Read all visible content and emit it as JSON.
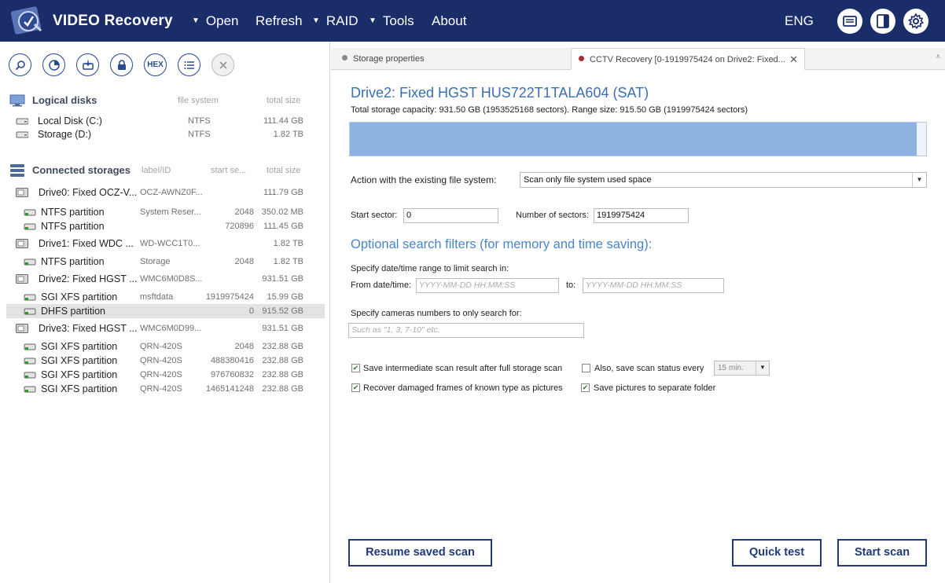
{
  "app": {
    "title": "VIDEO Recovery",
    "menu": [
      {
        "label": "Open",
        "has_arrow": true
      },
      {
        "label": "Refresh",
        "has_arrow": false
      },
      {
        "label": "RAID",
        "has_arrow": true
      },
      {
        "label": "Tools",
        "has_arrow": true
      },
      {
        "label": "About",
        "has_arrow": false
      }
    ],
    "language": "ENG",
    "header_icons": [
      "messages-icon",
      "panel-toggle-icon",
      "settings-gear-icon"
    ],
    "colors": {
      "titlebar": "#1b2d68",
      "accent": "#3a6fb0",
      "range_bar": "#8fb3e0",
      "button_border": "#1f3a78"
    }
  },
  "toolbar": {
    "icons": [
      "search-icon",
      "open-image-icon",
      "restore-icon",
      "lock-icon",
      "hex-icon",
      "list-icon",
      "close-icon"
    ],
    "hex_label": "HEX"
  },
  "logical_disks": {
    "title": "Logical disks",
    "col_fs": "file system",
    "col_size": "total size",
    "items": [
      {
        "name": "Local Disk (C:)",
        "fs": "NTFS",
        "size": "111.44 GB"
      },
      {
        "name": "Storage (D:)",
        "fs": "NTFS",
        "size": "1.82 TB"
      }
    ]
  },
  "connected": {
    "title": "Connected storages",
    "col_label": "label/ID",
    "col_start": "start se...",
    "col_size": "total size",
    "items": [
      {
        "name": "Drive0: Fixed OCZ-V...",
        "label": "OCZ-AWNZ0F...",
        "start": "",
        "size": "111.79 GB",
        "kind": "drive"
      },
      {
        "name": "NTFS partition",
        "label": "System Reser...",
        "start": "2048",
        "size": "350.02 MB",
        "kind": "partition"
      },
      {
        "name": "NTFS partition",
        "label": "",
        "start": "720896",
        "size": "111.45 GB",
        "kind": "partition"
      },
      {
        "name": "Drive1: Fixed WDC ...",
        "label": "WD-WCC1T0...",
        "start": "",
        "size": "1.82 TB",
        "kind": "drive"
      },
      {
        "name": "NTFS partition",
        "label": "Storage",
        "start": "2048",
        "size": "1.82 TB",
        "kind": "partition"
      },
      {
        "name": "Drive2: Fixed HGST ...",
        "label": "WMC6M0D8S...",
        "start": "",
        "size": "931.51 GB",
        "kind": "drive"
      },
      {
        "name": "SGI XFS partition",
        "label": "msftdata",
        "start": "1919975424",
        "size": "15.99 GB",
        "kind": "partition"
      },
      {
        "name": "DHFS partition",
        "label": "",
        "start": "0",
        "size": "915.52 GB",
        "kind": "partition",
        "selected": true
      },
      {
        "name": "Drive3: Fixed HGST ...",
        "label": "WMC6M0D99...",
        "start": "",
        "size": "931.51 GB",
        "kind": "drive"
      },
      {
        "name": "SGI XFS partition",
        "label": "QRN-420S",
        "start": "2048",
        "size": "232.88 GB",
        "kind": "partition"
      },
      {
        "name": "SGI XFS partition",
        "label": "QRN-420S",
        "start": "488380416",
        "size": "232.88 GB",
        "kind": "partition"
      },
      {
        "name": "SGI XFS partition",
        "label": "QRN-420S",
        "start": "976760832",
        "size": "232.88 GB",
        "kind": "partition"
      },
      {
        "name": "SGI XFS partition",
        "label": "QRN-420S",
        "start": "1465141248",
        "size": "232.88 GB",
        "kind": "partition"
      }
    ]
  },
  "tabs": [
    {
      "label": "Storage properties",
      "active": false
    },
    {
      "label": "CCTV Recovery [0-1919975424 on Drive2: Fixed...",
      "active": true
    }
  ],
  "main": {
    "drive_title": "Drive2: Fixed HGST HUS722T1TALA604 (SAT)",
    "capacity": "Total storage capacity: 931.50 GB (1953525168 sectors). Range size: 915.50 GB (1919975424 sectors)",
    "range_fill_fraction": 0.983,
    "action_label": "Action with the existing file system:",
    "action_value": "Scan only file system used space",
    "start_sector_label": "Start sector:",
    "start_sector_value": "0",
    "num_sectors_label": "Number of sectors:",
    "num_sectors_value": "1919975424",
    "optional_title": "Optional search filters (for memory and time saving):",
    "date_range_label": "Specify date/time range to limit search in:",
    "from_label": "From date/time:",
    "from_placeholder": "YYYY-MM-DD HH:MM:SS",
    "to_label": "to:",
    "to_placeholder": "YYYY-MM-DD HH:MM:SS",
    "cameras_label": "Specify cameras numbers to only search for:",
    "cameras_placeholder": "Such as \"1, 3, 7-10\" etc.",
    "check_save_intermediate": {
      "label": "Save intermediate scan result after full storage scan",
      "checked": true
    },
    "check_save_status": {
      "label": "Also, save scan status every",
      "checked": false
    },
    "status_interval": "15 min.",
    "check_recover_frames": {
      "label": "Recover damaged frames of known type as pictures",
      "checked": true
    },
    "check_separate_folder": {
      "label": "Save pictures to separate folder",
      "checked": true
    },
    "btn_resume": "Resume saved scan",
    "btn_quick": "Quick test",
    "btn_start": "Start scan"
  }
}
